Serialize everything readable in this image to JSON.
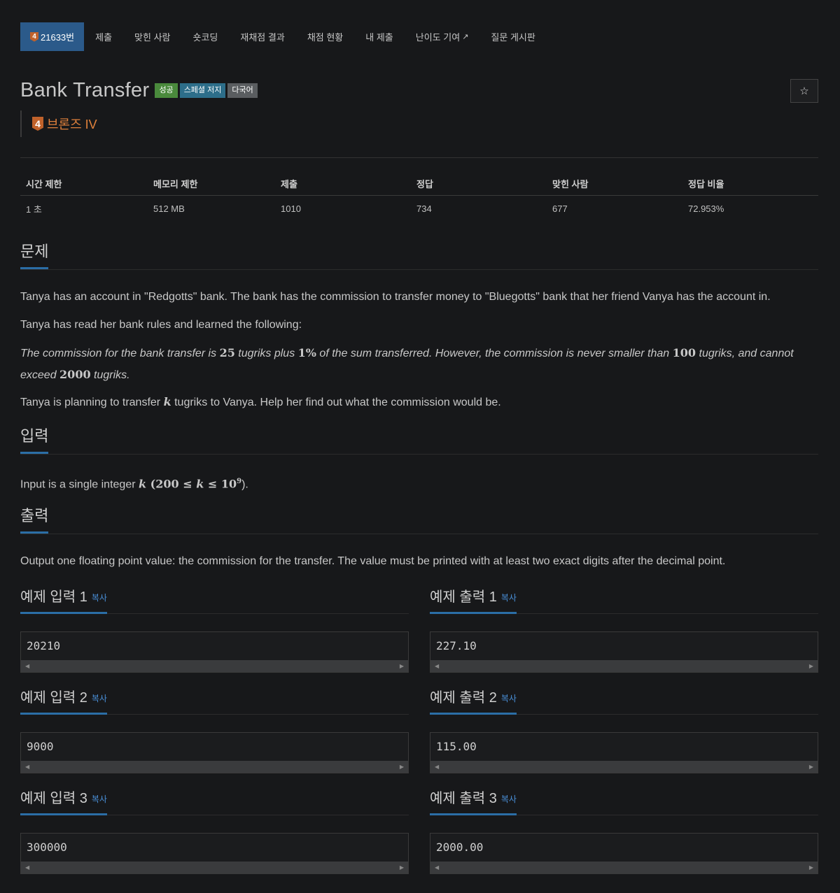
{
  "nav": {
    "problem_number": "21633번",
    "tier_digit": "4",
    "items": [
      "제출",
      "맞힌 사람",
      "숏코딩",
      "재채점 결과",
      "채점 현황",
      "내 제출",
      "난이도 기여",
      "질문 게시판"
    ]
  },
  "problem": {
    "title": "Bank Transfer",
    "labels": [
      "성공",
      "스페셜 저지",
      "다국어"
    ],
    "tier_digit": "4",
    "tier": "브론즈 IV",
    "star_icon": "☆"
  },
  "stats": {
    "headers": [
      "시간 제한",
      "메모리 제한",
      "제출",
      "정답",
      "맞힌 사람",
      "정답 비율"
    ],
    "values": [
      "1 초",
      "512 MB",
      "1010",
      "734",
      "677",
      "72.953%"
    ]
  },
  "sections": {
    "problem": "문제",
    "input": "입력",
    "output": "출력"
  },
  "statement": {
    "p1": "Tanya has an account in \"Redgotts\" bank. The bank has the commission to transfer money to \"Bluegotts\" bank that her friend Vanya has the account in.",
    "p2": "Tanya has read her bank rules and learned the following:",
    "p3a": "The commission for the bank transfer is ",
    "p3n1": "25",
    "p3b": " tugriks plus ",
    "p3n2": "1%",
    "p3c": " of the sum transferred. However, the commission is never smaller than ",
    "p3n3": "100",
    "p3d": " tugriks, and cannot exceed ",
    "p3n4": "2000",
    "p3e": " tugriks.",
    "p4a": "Tanya is planning to transfer ",
    "p4k": "k",
    "p4b": " tugriks to Vanya. Help her find out what the commission would be."
  },
  "input_text": {
    "a": "Input is a single integer ",
    "k": "k",
    "open": " (",
    "lo": "200",
    "le1": " ≤ ",
    "k2": "k",
    "le2": " ≤ ",
    "base": "10",
    "exp": "9",
    "close": ")."
  },
  "output_text": "Output one floating point value: the commission for the transfer. The value must be printed with at least two exact digits after the decimal point.",
  "copy_label": "복사",
  "samples": [
    {
      "in_title": "예제 입력 1",
      "in": "20210",
      "out_title": "예제 출력 1",
      "out": "227.10"
    },
    {
      "in_title": "예제 입력 2",
      "in": "9000",
      "out_title": "예제 출력 2",
      "out": "115.00"
    },
    {
      "in_title": "예제 입력 3",
      "in": "300000",
      "out_title": "예제 출력 3",
      "out": "2000.00"
    }
  ]
}
